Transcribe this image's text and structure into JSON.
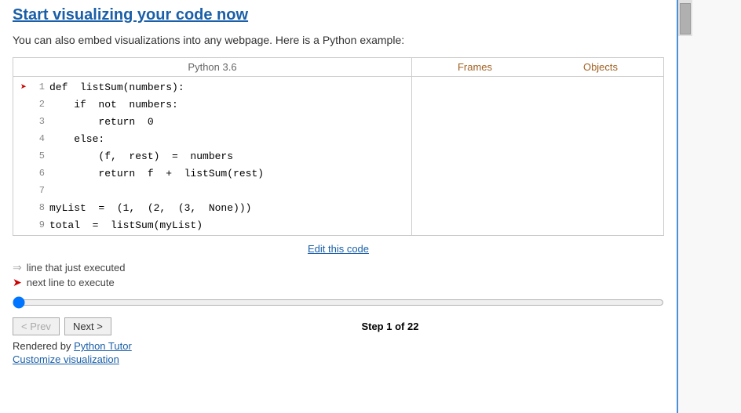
{
  "title": "Start visualizing your code now",
  "embed_description": "You can also embed visualizations into any webpage. Here is a Python example:",
  "code_panel": {
    "header": "Python 3.6",
    "lines": [
      {
        "num": 1,
        "code": "def  listSum(numbers):",
        "active": true,
        "arrow": "→"
      },
      {
        "num": 2,
        "code": "    if  not  numbers:",
        "active": false,
        "arrow": ""
      },
      {
        "num": 3,
        "code": "        return  0",
        "active": false,
        "arrow": ""
      },
      {
        "num": 4,
        "code": "    else:",
        "active": false,
        "arrow": ""
      },
      {
        "num": 5,
        "code": "        (f,  rest)  =  numbers",
        "active": false,
        "arrow": ""
      },
      {
        "num": 6,
        "code": "        return  f  +  listSum(rest)",
        "active": false,
        "arrow": ""
      },
      {
        "num": 7,
        "code": "",
        "active": false,
        "arrow": ""
      },
      {
        "num": 8,
        "code": "myList  =  (1,  (2,  (3,  None)))",
        "active": false,
        "arrow": ""
      },
      {
        "num": 9,
        "code": "total  =  listSum(myList)",
        "active": false,
        "arrow": ""
      }
    ]
  },
  "frames_label": "Frames",
  "objects_label": "Objects",
  "edit_link": "Edit this code",
  "legend": {
    "gray_arrow_text": "line that just executed",
    "red_arrow_text": "next line to execute"
  },
  "nav": {
    "prev_label": "< Prev",
    "next_label": "Next >",
    "step_label": "Step 1 of 22"
  },
  "rendered_by_text": "Rendered by ",
  "rendered_by_link": "Python Tutor",
  "customize_link": "Customize visualization"
}
